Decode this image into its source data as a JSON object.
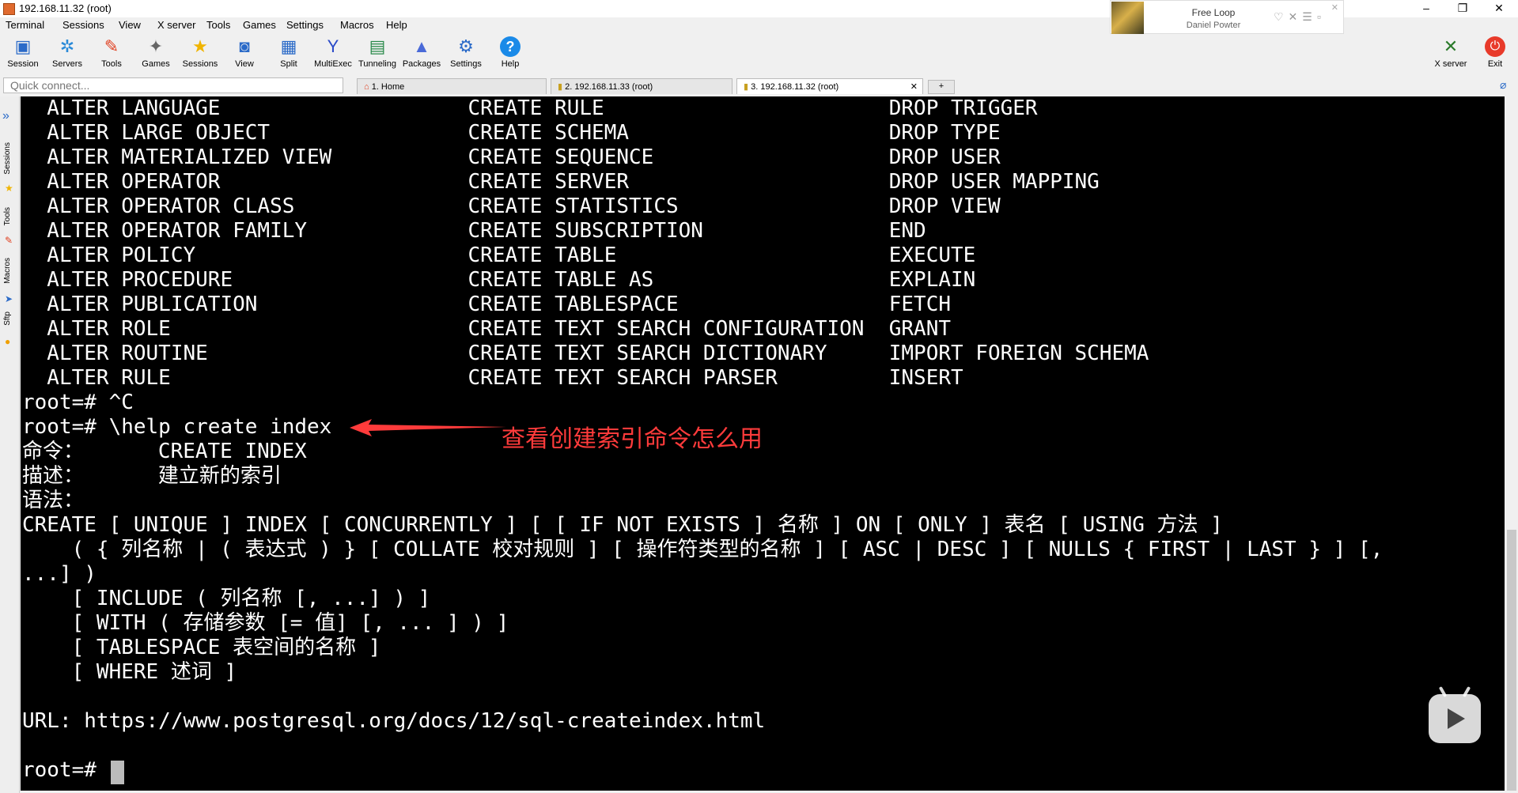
{
  "window": {
    "title": "192.168.11.32 (root)"
  },
  "menu": [
    "Terminal",
    "Sessions",
    "View",
    "X server",
    "Tools",
    "Games",
    "Settings",
    "Macros",
    "Help"
  ],
  "media": {
    "song": "Free Loop",
    "artist": "Daniel Powter"
  },
  "toolbar": {
    "items": [
      {
        "label": "Session",
        "icon": "monitor-icon"
      },
      {
        "label": "Servers",
        "icon": "servers-icon"
      },
      {
        "label": "Tools",
        "icon": "tools-icon"
      },
      {
        "label": "Games",
        "icon": "games-icon"
      },
      {
        "label": "Sessions",
        "icon": "star-icon"
      },
      {
        "label": "View",
        "icon": "view-icon"
      },
      {
        "label": "Split",
        "icon": "split-icon"
      },
      {
        "label": "MultiExec",
        "icon": "multiexec-icon"
      },
      {
        "label": "Tunneling",
        "icon": "tunneling-icon"
      },
      {
        "label": "Packages",
        "icon": "packages-icon"
      },
      {
        "label": "Settings",
        "icon": "settings-icon"
      },
      {
        "label": "Help",
        "icon": "help-icon"
      }
    ],
    "right": [
      {
        "label": "X server",
        "icon": "xserver-icon"
      },
      {
        "label": "Exit",
        "icon": "power-icon"
      }
    ]
  },
  "quick_connect": {
    "placeholder": "Quick connect..."
  },
  "tabs": [
    {
      "label": "1. Home",
      "active": false
    },
    {
      "label": "2. 192.168.11.33 (root)",
      "active": false
    },
    {
      "label": "3. 192.168.11.32 (root)",
      "active": true
    }
  ],
  "sidebar": [
    "Sessions",
    "Tools",
    "Macros",
    "Sftp"
  ],
  "terminal": {
    "lines": [
      "  ALTER LANGUAGE                    CREATE RULE                       DROP TRIGGER",
      "  ALTER LARGE OBJECT                CREATE SCHEMA                     DROP TYPE",
      "  ALTER MATERIALIZED VIEW           CREATE SEQUENCE                   DROP USER",
      "  ALTER OPERATOR                    CREATE SERVER                     DROP USER MAPPING",
      "  ALTER OPERATOR CLASS              CREATE STATISTICS                 DROP VIEW",
      "  ALTER OPERATOR FAMILY             CREATE SUBSCRIPTION               END",
      "  ALTER POLICY                      CREATE TABLE                      EXECUTE",
      "  ALTER PROCEDURE                   CREATE TABLE AS                   EXPLAIN",
      "  ALTER PUBLICATION                 CREATE TABLESPACE                 FETCH",
      "  ALTER ROLE                        CREATE TEXT SEARCH CONFIGURATION  GRANT",
      "  ALTER ROUTINE                     CREATE TEXT SEARCH DICTIONARY     IMPORT FOREIGN SCHEMA",
      "  ALTER RULE                        CREATE TEXT SEARCH PARSER         INSERT",
      "root=# ^C",
      "root=# \\help create index",
      "命令：      CREATE INDEX",
      "描述：      建立新的索引",
      "语法：",
      "CREATE [ UNIQUE ] INDEX [ CONCURRENTLY ] [ [ IF NOT EXISTS ] 名称 ] ON [ ONLY ] 表名 [ USING 方法 ]",
      "    ( { 列名称 | ( 表达式 ) } [ COLLATE 校对规则 ] [ 操作符类型的名称 ] [ ASC | DESC ] [ NULLS { FIRST | LAST } ] [,",
      "...] )",
      "    [ INCLUDE ( 列名称 [, ...] ) ]",
      "    [ WITH ( 存储参数 [= 值] [, ... ] ) ]",
      "    [ TABLESPACE 表空间的名称 ]",
      "    [ WHERE 述词 ]",
      "",
      "URL: https://www.postgresql.org/docs/12/sql-createindex.html",
      "",
      "root=# "
    ]
  },
  "annotation": {
    "text": "查看创建索引命令怎么用",
    "color": "#ff3b3b"
  }
}
